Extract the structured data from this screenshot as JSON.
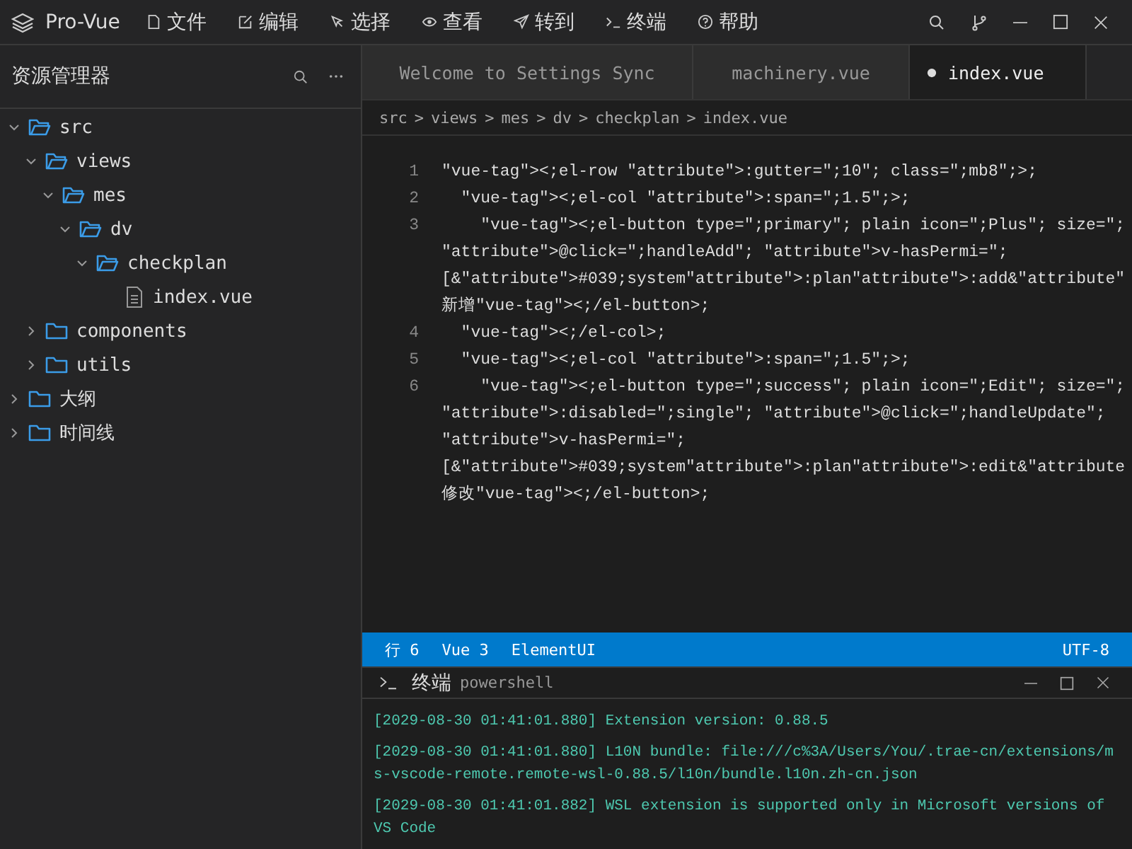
{
  "titlebar": {
    "app_name": "Pro-Vue",
    "menu": [
      {
        "label": "文件",
        "kind": "file"
      },
      {
        "label": "编辑",
        "kind": "edit"
      },
      {
        "label": "选择",
        "kind": "cursor"
      },
      {
        "label": "查看",
        "kind": "eye"
      },
      {
        "label": "转到",
        "kind": "send"
      },
      {
        "label": "终端",
        "kind": "terminal"
      },
      {
        "label": "帮助",
        "kind": "help"
      }
    ]
  },
  "sidebar": {
    "title": "资源管理器",
    "tree": [
      {
        "label": "src",
        "kind": "folder",
        "expanded": true,
        "children": [
          {
            "label": "views",
            "kind": "folder",
            "expanded": true,
            "children": [
              {
                "label": "mes",
                "kind": "folder",
                "expanded": true,
                "children": [
                  {
                    "label": "dv",
                    "kind": "folder",
                    "expanded": true,
                    "children": [
                      {
                        "label": "checkplan",
                        "kind": "folder",
                        "expanded": true,
                        "children": [
                          {
                            "label": "index.vue",
                            "kind": "file"
                          }
                        ]
                      }
                    ]
                  }
                ]
              }
            ]
          },
          {
            "label": "components",
            "kind": "folder",
            "expanded": false
          },
          {
            "label": "utils",
            "kind": "folder",
            "expanded": false
          }
        ]
      },
      {
        "label": "大纲",
        "kind": "folder",
        "expanded": false
      },
      {
        "label": "时间线",
        "kind": "folder",
        "expanded": false
      }
    ]
  },
  "tabs": [
    {
      "label": "Welcome to Settings Sync",
      "selected": false,
      "modified": false
    },
    {
      "label": "machinery.vue",
      "selected": false,
      "modified": false
    },
    {
      "label": "index.vue",
      "selected": true,
      "modified": true
    }
  ],
  "breadcrumb": [
    "src",
    "views",
    "mes",
    "dv",
    "checkplan",
    "index.vue"
  ],
  "breadcrumb_separator": ">",
  "code_lines": [
    {
      "number": "1",
      "lines": [
        "\"vue-tag\"><;el-row \"attribute\">:gutter=\";10\"; class=\";mb8\";>;"
      ]
    },
    {
      "number": "2",
      "lines": [
        "  \"vue-tag\"><;el-col \"attribute\">:span=\";1.5\";>;"
      ]
    },
    {
      "number": "3",
      "lines": [
        "    \"vue-tag\"><;el-button type=\";primary\"; plain icon=\";Plus\"; size=\";",
        "\"attribute\">@click=\";handleAdd\"; \"attribute\">v-hasPermi=\";",
        "[&\"attribute\">#039;system\"attribute\">:plan\"attribute\">:add&\"attribute\"",
        "新增\"vue-tag\"><;/el-button>;"
      ]
    },
    {
      "number": "4",
      "lines": [
        "  \"vue-tag\"><;/el-col>;"
      ]
    },
    {
      "number": "5",
      "lines": [
        "  \"vue-tag\"><;el-col \"attribute\">:span=\";1.5\";>;"
      ]
    },
    {
      "number": "6",
      "lines": [
        "    \"vue-tag\"><;el-button type=\";success\"; plain icon=\";Edit\"; size=\";",
        "\"attribute\">:disabled=\";single\"; \"attribute\">@click=\";handleUpdate\";",
        "\"attribute\">v-hasPermi=\";",
        "[&\"attribute\">#039;system\"attribute\">:plan\"attribute\">:edit&\"attribute",
        "修改\"vue-tag\"><;/el-button>;"
      ]
    }
  ],
  "status_bar": {
    "left": [
      "行 6",
      "Vue 3",
      "ElementUI"
    ],
    "right": [
      "UTF-8"
    ]
  },
  "terminal": {
    "title": "终端",
    "shell": "powershell",
    "logs": [
      "[2029-08-30 01:41:01.880] Extension version: 0.88.5",
      "[2029-08-30 01:41:01.880] L10N bundle: file:///c%3A/Users/You/.trae-cn/extensions/ms-vscode-remote.remote-wsl-0.88.5/l10n/bundle.l10n.zh-cn.json",
      "[2029-08-30 01:41:01.882] WSL extension is supported only in Microsoft versions of VS Code"
    ]
  }
}
